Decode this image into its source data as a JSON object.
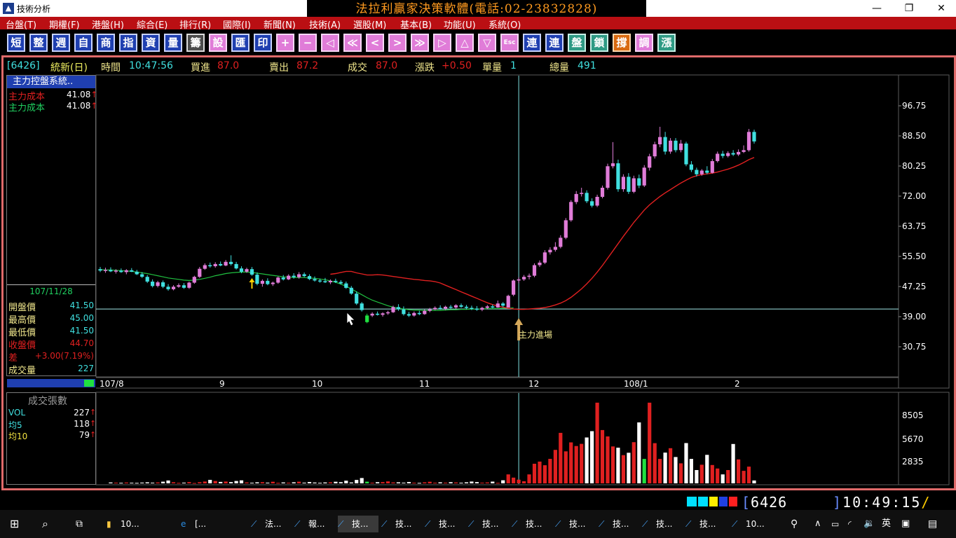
{
  "window": {
    "title": "技術分析",
    "banner": "法拉利贏家決策軟體(電話:02-23832828)"
  },
  "menu": [
    "台盤(T)",
    "期權(F)",
    "港盤(H)",
    "綜合(E)",
    "排行(R)",
    "國際(I)",
    "新聞(N)",
    "技術(A)",
    "選股(M)",
    "基本(B)",
    "功能(U)",
    "系統(O)"
  ],
  "toolbar": {
    "buttons": [
      "短",
      "整",
      "週",
      "自",
      "商",
      "指",
      "資",
      "量",
      "籌",
      "設",
      "匯",
      "印",
      "+",
      "−",
      "◁",
      "≪",
      "<",
      ">",
      "≫",
      "▷",
      "△",
      "▽",
      "Esc",
      "連",
      "連",
      "盤",
      "鎖",
      "撐",
      "調",
      "漲"
    ]
  },
  "quote": {
    "code": "[6426]",
    "name": "統新(日)",
    "time_label": "時間",
    "time": "10:47:56",
    "bid_label": "買進",
    "bid": "87.0",
    "ask_label": "賣出",
    "ask": "87.2",
    "deal_label": "成交",
    "deal": "87.0",
    "change_label": "漲跌",
    "change": "+0.50",
    "unit_label": "單量",
    "unit": "1",
    "total_label": "總量",
    "total": "491"
  },
  "indicator": {
    "title": "主力控盤系統..",
    "rows": [
      {
        "label": "主力成本",
        "value": "41.08",
        "color": "#e02020"
      },
      {
        "label": "主力成本",
        "value": "41.08",
        "color": "#20d060"
      }
    ]
  },
  "day_info": {
    "date": "107/11/28",
    "rows": [
      {
        "label": "開盤價",
        "value": "41.50",
        "color": "#40e0e0"
      },
      {
        "label": "最高價",
        "value": "45.00",
        "color": "#40e0e0"
      },
      {
        "label": "最低價",
        "value": "41.50",
        "color": "#40e0e0"
      },
      {
        "label": "收盤價",
        "value": "44.70",
        "color": "#e02020"
      },
      {
        "label": "差",
        "value": "+3.00(7.19%)",
        "color": "#e02020"
      },
      {
        "label": "成交量",
        "value": "227",
        "color": "#40e0e0"
      }
    ]
  },
  "price_axis": [
    "96.75",
    "88.50",
    "80.25",
    "72.00",
    "63.75",
    "55.50",
    "47.25",
    "39.00",
    "30.75"
  ],
  "date_axis": [
    "107/8",
    "9",
    "10",
    "11",
    "12",
    "108/1",
    "2"
  ],
  "annotation": "主力進場",
  "volume_panel": {
    "title": "成交張數",
    "rows": [
      {
        "label": "VOL",
        "value": "227",
        "color": "#40e0e0"
      },
      {
        "label": "均5",
        "value": "118",
        "color": "#40e0e0"
      },
      {
        "label": "均10",
        "value": "79",
        "color": "#f0e040"
      }
    ],
    "axis": [
      "8505",
      "5670",
      "2835"
    ]
  },
  "status": {
    "code": "6426",
    "clock": "10:49:15"
  },
  "taskbar": {
    "items": [
      "10...",
      "[...",
      "法...",
      "報...",
      "技...",
      "技...",
      "技...",
      "技...",
      "技...",
      "技...",
      "技...",
      "技...",
      "技...",
      "10..."
    ],
    "ime": "英"
  },
  "colors": {
    "up": "#e07cd8",
    "down": "#40e0e0",
    "up_volume": "#e02020",
    "ma": "#20c040",
    "cost_line": "#e02020",
    "menu_bg": "#ba0f13"
  },
  "chart_data": {
    "type": "candlestick",
    "y_range": [
      30.75,
      96.75
    ],
    "candles": [
      {
        "o": 52.0,
        "h": 52.6,
        "l": 51.2,
        "c": 51.6
      },
      {
        "o": 51.6,
        "h": 52.4,
        "l": 51.0,
        "c": 51.8
      },
      {
        "o": 51.8,
        "h": 52.5,
        "l": 51.2,
        "c": 51.4
      },
      {
        "o": 51.4,
        "h": 52.0,
        "l": 50.8,
        "c": 51.6
      },
      {
        "o": 51.6,
        "h": 52.2,
        "l": 51.0,
        "c": 51.2
      },
      {
        "o": 51.2,
        "h": 52.0,
        "l": 50.6,
        "c": 51.7
      },
      {
        "o": 51.7,
        "h": 52.3,
        "l": 51.2,
        "c": 51.3
      },
      {
        "o": 51.3,
        "h": 51.8,
        "l": 50.4,
        "c": 50.6
      },
      {
        "o": 50.6,
        "h": 51.2,
        "l": 49.6,
        "c": 49.9
      },
      {
        "o": 49.9,
        "h": 50.4,
        "l": 48.2,
        "c": 48.6
      },
      {
        "o": 48.6,
        "h": 49.2,
        "l": 47.0,
        "c": 47.4
      },
      {
        "o": 47.4,
        "h": 48.8,
        "l": 47.0,
        "c": 48.4
      },
      {
        "o": 48.4,
        "h": 48.9,
        "l": 46.8,
        "c": 47.2
      },
      {
        "o": 47.2,
        "h": 47.9,
        "l": 46.1,
        "c": 46.5
      },
      {
        "o": 46.5,
        "h": 47.6,
        "l": 46.2,
        "c": 47.2
      },
      {
        "o": 47.2,
        "h": 48.1,
        "l": 46.9,
        "c": 47.6
      },
      {
        "o": 47.6,
        "h": 48.2,
        "l": 46.6,
        "c": 46.9
      },
      {
        "o": 46.9,
        "h": 48.6,
        "l": 46.6,
        "c": 48.3
      },
      {
        "o": 48.3,
        "h": 50.2,
        "l": 48.0,
        "c": 49.9
      },
      {
        "o": 49.9,
        "h": 52.6,
        "l": 49.6,
        "c": 52.1
      },
      {
        "o": 52.1,
        "h": 53.6,
        "l": 51.8,
        "c": 53.1
      },
      {
        "o": 53.1,
        "h": 53.8,
        "l": 52.4,
        "c": 52.8
      },
      {
        "o": 52.8,
        "h": 53.9,
        "l": 52.4,
        "c": 53.4
      },
      {
        "o": 53.4,
        "h": 54.1,
        "l": 52.8,
        "c": 53.0
      },
      {
        "o": 53.0,
        "h": 54.5,
        "l": 52.8,
        "c": 54.0
      },
      {
        "o": 54.0,
        "h": 55.8,
        "l": 53.0,
        "c": 53.4
      },
      {
        "o": 53.4,
        "h": 54.0,
        "l": 51.9,
        "c": 52.2
      },
      {
        "o": 52.2,
        "h": 52.8,
        "l": 50.9,
        "c": 51.3
      },
      {
        "o": 51.3,
        "h": 52.4,
        "l": 51.0,
        "c": 52.0
      },
      {
        "o": 52.0,
        "h": 52.6,
        "l": 50.2,
        "c": 50.5
      },
      {
        "o": 50.5,
        "h": 51.1,
        "l": 47.6,
        "c": 48.0
      },
      {
        "o": 48.0,
        "h": 49.2,
        "l": 47.2,
        "c": 48.8
      },
      {
        "o": 48.8,
        "h": 49.5,
        "l": 47.6,
        "c": 47.9
      },
      {
        "o": 47.9,
        "h": 48.6,
        "l": 47.4,
        "c": 48.3
      },
      {
        "o": 48.3,
        "h": 50.0,
        "l": 48.0,
        "c": 49.7
      },
      {
        "o": 49.7,
        "h": 50.4,
        "l": 48.9,
        "c": 49.2
      },
      {
        "o": 49.2,
        "h": 50.6,
        "l": 49.0,
        "c": 50.2
      },
      {
        "o": 50.2,
        "h": 50.9,
        "l": 49.4,
        "c": 49.8
      },
      {
        "o": 49.8,
        "h": 51.2,
        "l": 49.4,
        "c": 50.6
      },
      {
        "o": 50.6,
        "h": 51.1,
        "l": 49.8,
        "c": 50.1
      },
      {
        "o": 50.1,
        "h": 50.6,
        "l": 49.0,
        "c": 49.3
      },
      {
        "o": 49.3,
        "h": 50.0,
        "l": 48.6,
        "c": 48.9
      },
      {
        "o": 48.9,
        "h": 49.4,
        "l": 48.3,
        "c": 48.7
      },
      {
        "o": 48.7,
        "h": 49.6,
        "l": 48.2,
        "c": 48.4
      },
      {
        "o": 48.4,
        "h": 49.2,
        "l": 47.9,
        "c": 48.8
      },
      {
        "o": 48.8,
        "h": 49.4,
        "l": 48.2,
        "c": 48.5
      },
      {
        "o": 48.5,
        "h": 49.0,
        "l": 47.8,
        "c": 48.1
      },
      {
        "o": 48.1,
        "h": 48.6,
        "l": 46.6,
        "c": 46.9
      },
      {
        "o": 46.9,
        "h": 47.4,
        "l": 45.0,
        "c": 45.3
      },
      {
        "o": 45.3,
        "h": 45.9,
        "l": 42.2,
        "c": 42.6
      },
      {
        "o": 42.6,
        "h": 43.0,
        "l": 40.4,
        "c": 40.8
      },
      {
        "o": 37.5,
        "h": 39.8,
        "l": 37.2,
        "c": 39.3
      },
      {
        "o": 39.3,
        "h": 40.2,
        "l": 38.9,
        "c": 39.8
      },
      {
        "o": 39.8,
        "h": 40.4,
        "l": 39.3,
        "c": 39.5
      },
      {
        "o": 39.5,
        "h": 40.2,
        "l": 39.0,
        "c": 39.9
      },
      {
        "o": 39.9,
        "h": 40.6,
        "l": 39.5,
        "c": 40.2
      },
      {
        "o": 40.2,
        "h": 42.0,
        "l": 40.0,
        "c": 41.6
      },
      {
        "o": 41.6,
        "h": 42.4,
        "l": 40.6,
        "c": 41.0
      },
      {
        "o": 41.0,
        "h": 41.8,
        "l": 39.3,
        "c": 39.7
      },
      {
        "o": 39.7,
        "h": 40.3,
        "l": 38.9,
        "c": 39.3
      },
      {
        "o": 39.3,
        "h": 40.4,
        "l": 39.0,
        "c": 40.0
      },
      {
        "o": 40.0,
        "h": 40.6,
        "l": 39.4,
        "c": 39.7
      },
      {
        "o": 39.7,
        "h": 41.0,
        "l": 39.5,
        "c": 40.6
      },
      {
        "o": 40.6,
        "h": 41.4,
        "l": 40.2,
        "c": 41.0
      },
      {
        "o": 41.0,
        "h": 41.8,
        "l": 40.8,
        "c": 41.4
      },
      {
        "o": 41.4,
        "h": 42.1,
        "l": 40.9,
        "c": 41.2
      },
      {
        "o": 41.2,
        "h": 42.0,
        "l": 40.8,
        "c": 41.7
      },
      {
        "o": 41.7,
        "h": 42.2,
        "l": 41.2,
        "c": 41.5
      },
      {
        "o": 41.5,
        "h": 42.4,
        "l": 41.2,
        "c": 42.1
      },
      {
        "o": 42.1,
        "h": 42.6,
        "l": 41.4,
        "c": 41.7
      },
      {
        "o": 41.7,
        "h": 42.2,
        "l": 41.0,
        "c": 41.4
      },
      {
        "o": 41.4,
        "h": 42.0,
        "l": 40.8,
        "c": 41.2
      },
      {
        "o": 41.2,
        "h": 41.9,
        "l": 40.6,
        "c": 40.9
      },
      {
        "o": 40.9,
        "h": 41.7,
        "l": 40.5,
        "c": 41.4
      },
      {
        "o": 41.4,
        "h": 42.2,
        "l": 41.0,
        "c": 41.8
      },
      {
        "o": 41.8,
        "h": 42.3,
        "l": 41.3,
        "c": 41.5
      },
      {
        "o": 41.5,
        "h": 43.4,
        "l": 41.4,
        "c": 42.6
      },
      {
        "o": 42.6,
        "h": 43.0,
        "l": 41.6,
        "c": 42.0
      },
      {
        "o": 41.5,
        "h": 45.0,
        "l": 41.5,
        "c": 44.7
      },
      {
        "o": 45.0,
        "h": 49.2,
        "l": 44.6,
        "c": 48.9
      },
      {
        "o": 48.9,
        "h": 49.8,
        "l": 48.2,
        "c": 49.2
      },
      {
        "o": 49.2,
        "h": 50.4,
        "l": 48.8,
        "c": 49.9
      },
      {
        "o": 49.9,
        "h": 50.8,
        "l": 49.2,
        "c": 50.2
      },
      {
        "o": 50.2,
        "h": 53.6,
        "l": 49.8,
        "c": 53.1
      },
      {
        "o": 53.1,
        "h": 54.4,
        "l": 52.6,
        "c": 53.8
      },
      {
        "o": 53.8,
        "h": 57.2,
        "l": 53.4,
        "c": 56.6
      },
      {
        "o": 56.6,
        "h": 58.0,
        "l": 56.0,
        "c": 57.3
      },
      {
        "o": 57.3,
        "h": 59.4,
        "l": 56.8,
        "c": 58.1
      },
      {
        "o": 58.1,
        "h": 61.3,
        "l": 57.7,
        "c": 60.6
      },
      {
        "o": 60.6,
        "h": 66.0,
        "l": 60.2,
        "c": 65.4
      },
      {
        "o": 65.4,
        "h": 70.9,
        "l": 65.0,
        "c": 70.4
      },
      {
        "o": 70.4,
        "h": 73.4,
        "l": 69.8,
        "c": 72.6
      },
      {
        "o": 72.6,
        "h": 74.3,
        "l": 71.9,
        "c": 72.9
      },
      {
        "o": 72.9,
        "h": 73.6,
        "l": 70.1,
        "c": 70.6
      },
      {
        "o": 70.6,
        "h": 71.4,
        "l": 68.9,
        "c": 69.4
      },
      {
        "o": 69.4,
        "h": 72.4,
        "l": 69.0,
        "c": 71.8
      },
      {
        "o": 71.8,
        "h": 74.9,
        "l": 71.4,
        "c": 74.3
      },
      {
        "o": 74.3,
        "h": 80.9,
        "l": 73.8,
        "c": 80.2
      },
      {
        "o": 80.2,
        "h": 86.8,
        "l": 79.6,
        "c": 81.0
      },
      {
        "o": 81.0,
        "h": 82.0,
        "l": 73.2,
        "c": 73.9
      },
      {
        "o": 73.9,
        "h": 78.0,
        "l": 73.2,
        "c": 77.3
      },
      {
        "o": 77.3,
        "h": 78.3,
        "l": 72.6,
        "c": 73.2
      },
      {
        "o": 73.2,
        "h": 77.6,
        "l": 72.8,
        "c": 76.9
      },
      {
        "o": 76.9,
        "h": 77.9,
        "l": 74.2,
        "c": 74.9
      },
      {
        "o": 74.9,
        "h": 80.5,
        "l": 74.5,
        "c": 79.8
      },
      {
        "o": 79.8,
        "h": 83.6,
        "l": 79.0,
        "c": 82.9
      },
      {
        "o": 82.9,
        "h": 86.9,
        "l": 82.3,
        "c": 86.2
      },
      {
        "o": 86.2,
        "h": 91.0,
        "l": 85.4,
        "c": 88.2
      },
      {
        "o": 88.2,
        "h": 89.6,
        "l": 83.4,
        "c": 84.2
      },
      {
        "o": 84.2,
        "h": 87.9,
        "l": 83.6,
        "c": 87.2
      },
      {
        "o": 87.2,
        "h": 87.9,
        "l": 84.0,
        "c": 84.6
      },
      {
        "o": 84.6,
        "h": 87.4,
        "l": 84.0,
        "c": 86.4
      },
      {
        "o": 86.4,
        "h": 86.9,
        "l": 80.2,
        "c": 80.7
      },
      {
        "o": 80.7,
        "h": 81.6,
        "l": 78.6,
        "c": 79.2
      },
      {
        "o": 79.2,
        "h": 79.8,
        "l": 77.4,
        "c": 78.0
      },
      {
        "o": 78.0,
        "h": 79.4,
        "l": 77.6,
        "c": 79.0
      },
      {
        "o": 79.0,
        "h": 80.2,
        "l": 78.0,
        "c": 78.4
      },
      {
        "o": 78.4,
        "h": 82.2,
        "l": 78.2,
        "c": 81.6
      },
      {
        "o": 81.6,
        "h": 84.2,
        "l": 81.2,
        "c": 83.6
      },
      {
        "o": 83.6,
        "h": 84.4,
        "l": 82.4,
        "c": 83.0
      },
      {
        "o": 83.0,
        "h": 84.3,
        "l": 82.6,
        "c": 83.8
      },
      {
        "o": 83.8,
        "h": 84.6,
        "l": 83.0,
        "c": 83.4
      },
      {
        "o": 83.4,
        "h": 84.8,
        "l": 83.0,
        "c": 84.1
      },
      {
        "o": 84.1,
        "h": 85.9,
        "l": 83.8,
        "c": 84.6
      },
      {
        "o": 84.6,
        "h": 90.4,
        "l": 84.2,
        "c": 89.6
      },
      {
        "o": 89.6,
        "h": 90.2,
        "l": 86.4,
        "c": 87.0
      }
    ],
    "ma": [
      51.9,
      51.8,
      51.8,
      51.7,
      51.6,
      51.5,
      51.4,
      51.2,
      51.0,
      50.8,
      50.5,
      50.2,
      49.9,
      49.6,
      49.4,
      49.2,
      49.0,
      48.9,
      49.0,
      49.2,
      49.5,
      49.8,
      50.2,
      50.5,
      50.8,
      51.0,
      51.1,
      51.2,
      51.2,
      51.1,
      50.9,
      50.7,
      50.5,
      50.3,
      50.1,
      49.9,
      49.8,
      49.7,
      49.7,
      49.7,
      49.6,
      49.5,
      49.3,
      49.1,
      48.8,
      48.4,
      47.9,
      47.3,
      46.6,
      45.8,
      45.0,
      44.2,
      43.5,
      43.0,
      42.5,
      42.0,
      41.6,
      41.3,
      41.1,
      40.9,
      40.8,
      40.8,
      40.7,
      40.7,
      40.7,
      40.7,
      40.8,
      40.9,
      40.9,
      41.0,
      41.0,
      41.1,
      41.1,
      41.1,
      41.2,
      41.2,
      41.2,
      41.3,
      41.3,
      41.4
    ],
    "cost_line": [
      50.6,
      50.8,
      51.1,
      51.4,
      51.4,
      51.0,
      50.7,
      50.4,
      50.4,
      50.5,
      50.4,
      50.2,
      50.0,
      49.8,
      49.6,
      49.4,
      49.2,
      49.1,
      48.9,
      48.8,
      48.6,
      48.2,
      47.6,
      47.0,
      46.4,
      45.8,
      45.2,
      44.6,
      44.0,
      43.4,
      42.8,
      42.3,
      41.9,
      41.6,
      41.3,
      41.1,
      41.0,
      41.0,
      41.1,
      41.2,
      41.3,
      41.5,
      41.8,
      42.2,
      42.7,
      43.4,
      44.3,
      45.4,
      46.6,
      48.0,
      49.5,
      51.2,
      53.0,
      55.0,
      57.0,
      59.0,
      61.0,
      62.9,
      64.8,
      66.5,
      68.2,
      69.6,
      70.8,
      71.9,
      72.9,
      73.8,
      74.7,
      75.6,
      76.4,
      77.1,
      77.6,
      77.9,
      78.1,
      78.3,
      78.6,
      79.0,
      79.4,
      79.9,
      80.5,
      81.2,
      82.0,
      82.6
    ],
    "cost_level": 41.08,
    "volume_y_range": [
      0,
      11340
    ],
    "volume": [
      120,
      90,
      70,
      110,
      80,
      60,
      100,
      140,
      90,
      120,
      220,
      380,
      150,
      60,
      90,
      170,
      50,
      150,
      240,
      460,
      310,
      190,
      240,
      170,
      310,
      400,
      120,
      80,
      140,
      160,
      90,
      210,
      60,
      120,
      80,
      140,
      220,
      90,
      180,
      110,
      70,
      120,
      140,
      210,
      160,
      350,
      120,
      450,
      700,
      220,
      80,
      160,
      170,
      260,
      120,
      140,
      90,
      180,
      80,
      60,
      140,
      210,
      80,
      140,
      90,
      160,
      120,
      80,
      140,
      240,
      170,
      90,
      120,
      230,
      60,
      410,
      1180,
      760,
      490,
      280,
      1180,
      2580,
      2870,
      2390,
      3230,
      4410,
      6650,
      4210,
      5390,
      4910,
      5200,
      6040,
      6870,
      10620,
      7020,
      6180,
      4860,
      4690,
      3720,
      4030,
      5420,
      8020,
      3220,
      10620,
      5290,
      3220,
      4050,
      4630,
      3470,
      2640,
      5300,
      3220,
      1750,
      2450,
      3750,
      2420,
      1950,
      1180,
      1750,
      5180,
      3150,
      1650,
      2200,
      380
    ]
  }
}
